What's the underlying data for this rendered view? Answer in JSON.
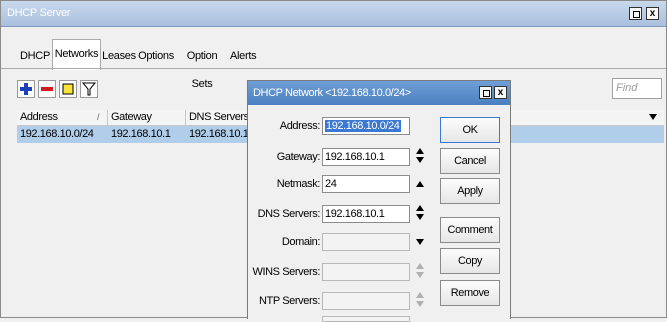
{
  "window": {
    "title": "DHCP Server"
  },
  "tabs": [
    {
      "label": "DHCP"
    },
    {
      "label": "Networks",
      "active": true
    },
    {
      "label": "Leases"
    },
    {
      "label": "Options"
    },
    {
      "label": "Option Sets"
    },
    {
      "label": "Alerts"
    }
  ],
  "toolbar": {
    "add_icon": "plus-icon",
    "remove_icon": "minus-icon",
    "comment_icon": "note-icon",
    "filter_icon": "filter-icon",
    "find_placeholder": "Find"
  },
  "table": {
    "columns": [
      "Address",
      "Gateway",
      "DNS Servers"
    ],
    "rows": [
      {
        "address": "192.168.10.0/24",
        "gateway": "192.168.10.1",
        "dns": "192.168.10.1"
      }
    ]
  },
  "dialog": {
    "title": "DHCP Network <192.168.10.0/24>",
    "fields": {
      "address_label": "Address:",
      "address_value": "192.168.10.0/24",
      "gateway_label": "Gateway:",
      "gateway_value": "192.168.10.1",
      "netmask_label": "Netmask:",
      "netmask_value": "24",
      "dns_label": "DNS Servers:",
      "dns_value": "192.168.10.1",
      "domain_label": "Domain:",
      "domain_value": "",
      "wins_label": "WINS Servers:",
      "wins_value": "",
      "ntp_label": "NTP Servers:",
      "ntp_value": ""
    },
    "buttons": {
      "ok": "OK",
      "cancel": "Cancel",
      "apply": "Apply",
      "comment": "Comment",
      "copy": "Copy",
      "remove": "Remove"
    }
  },
  "colors": {
    "selection": "#b0cde9",
    "dialog_title": "#4a7fc1",
    "highlight": "#3a78d1"
  }
}
